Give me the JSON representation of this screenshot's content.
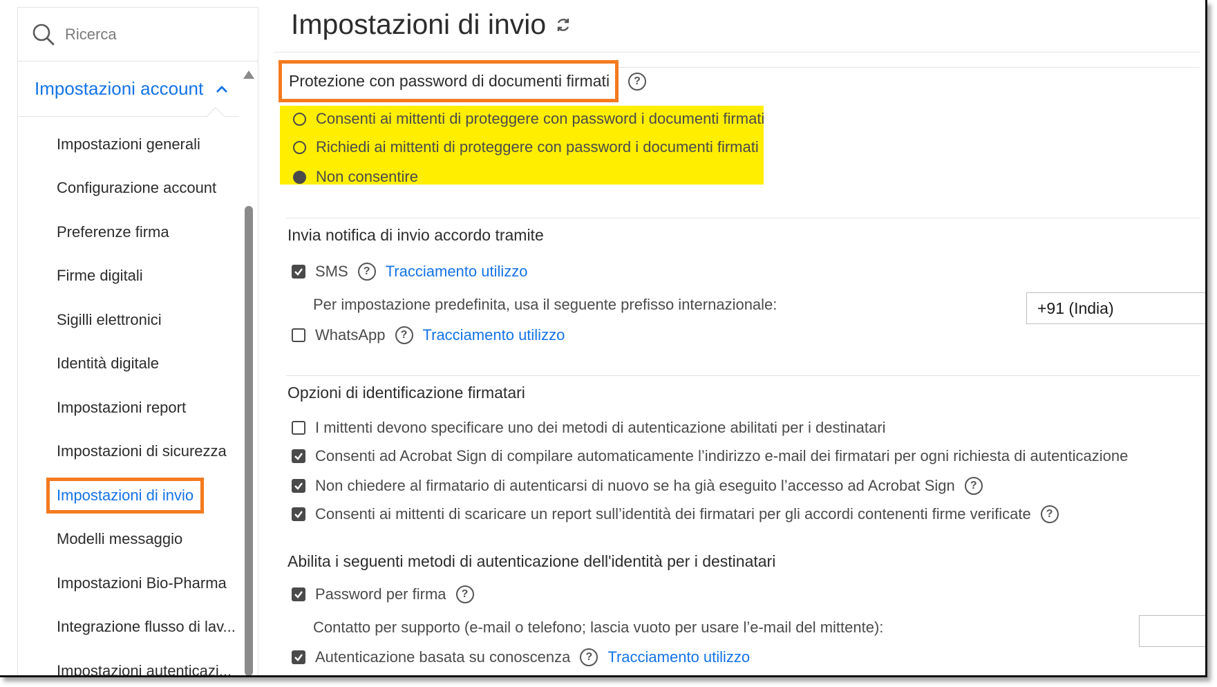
{
  "search": {
    "placeholder": "Ricerca"
  },
  "sidebar": {
    "header": "Impostazioni account",
    "items": [
      {
        "label": "Impostazioni generali"
      },
      {
        "label": "Configurazione account"
      },
      {
        "label": "Preferenze firma"
      },
      {
        "label": "Firme digitali"
      },
      {
        "label": "Sigilli elettronici"
      },
      {
        "label": "Identità digitale"
      },
      {
        "label": "Impostazioni report"
      },
      {
        "label": "Impostazioni di sicurezza"
      },
      {
        "label": "Impostazioni di invio",
        "active": true
      },
      {
        "label": "Modelli messaggio"
      },
      {
        "label": "Impostazioni Bio-Pharma"
      },
      {
        "label": "Integrazione flusso di lav..."
      },
      {
        "label": "Impostazioni autenticazi..."
      }
    ]
  },
  "page": {
    "title": "Impostazioni di invio"
  },
  "password_protection": {
    "title": "Protezione con password di documenti firmati",
    "options": [
      {
        "label": "Consenti ai mittenti di proteggere con password i documenti firmati",
        "selected": false
      },
      {
        "label": "Richiedi ai mittenti di proteggere con password i documenti firmati",
        "selected": false
      },
      {
        "label": "Non consentire",
        "selected": true
      }
    ]
  },
  "notification": {
    "title": "Invia notifica di invio accordo tramite",
    "sms": {
      "label": "SMS",
      "checked": true,
      "link": "Tracciamento utilizzo"
    },
    "prefix_label": "Per impostazione predefinita, usa il seguente prefisso internazionale:",
    "prefix_value": "+91 (India)",
    "whatsapp": {
      "label": "WhatsApp",
      "checked": false,
      "link": "Tracciamento utilizzo"
    }
  },
  "signer_identification": {
    "title": "Opzioni di identificazione firmatari",
    "options": [
      {
        "label": "I mittenti devono specificare uno dei metodi di autenticazione abilitati per i destinatari",
        "checked": false
      },
      {
        "label": "Consenti ad Acrobat Sign di compilare automaticamente l’indirizzo e-mail dei firmatari per ogni richiesta di autenticazione",
        "checked": true
      },
      {
        "label": "Non chiedere al firmatario di autenticarsi di nuovo se ha già eseguito l’accesso ad Acrobat Sign",
        "checked": true
      },
      {
        "label": "Consenti ai mittenti di scaricare un report sull’identità dei firmatari per gli accordi contenenti firme verificate",
        "checked": true
      }
    ]
  },
  "auth_methods": {
    "title": "Abilita i seguenti metodi di autenticazione dell'identità per i destinatari",
    "password": {
      "label": "Password per firma",
      "checked": true
    },
    "support_contact_label": "Contatto per supporto (e-mail o telefono; lascia vuoto per usare l’e-mail del mittente):",
    "support_contact_value": "",
    "kba": {
      "label": "Autenticazione basata su conoscenza",
      "checked": true,
      "link": "Tracciamento utilizzo"
    }
  },
  "colors": {
    "accent": "#1473e6",
    "highlight_box": "#f47a20",
    "highlight_fill": "#ffee00"
  }
}
